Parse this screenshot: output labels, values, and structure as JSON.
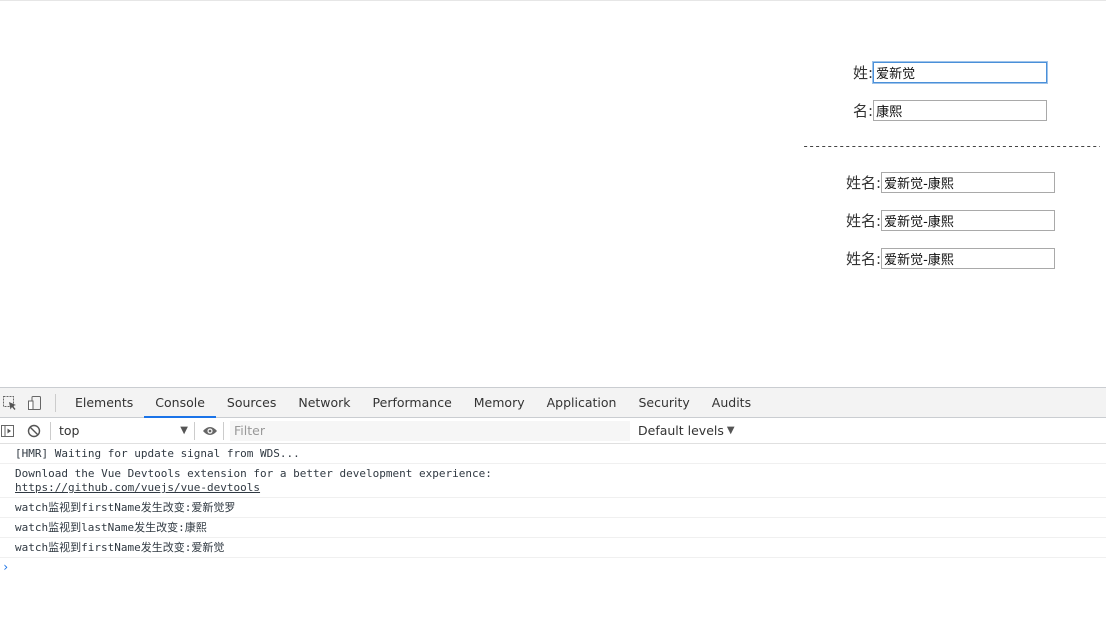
{
  "form": {
    "first_label": "姓:",
    "first_value": "爱新觉",
    "last_label": "名:",
    "last_value": "康熙",
    "divider": "-----------------------------------------------------------------------",
    "full_rows": [
      {
        "label": "姓名:",
        "value": "爱新觉-康熙"
      },
      {
        "label": "姓名:",
        "value": "爱新觉-康熙"
      },
      {
        "label": "姓名:",
        "value": "爱新觉-康熙"
      }
    ]
  },
  "devtools": {
    "tabs": [
      "Elements",
      "Console",
      "Sources",
      "Network",
      "Performance",
      "Memory",
      "Application",
      "Security",
      "Audits"
    ],
    "active_tab": "Console",
    "context": "top",
    "filter_placeholder": "Filter",
    "levels_label": "Default levels",
    "icons": [
      "inspect-element-icon",
      "device-toggle-icon",
      "sidebar-toggle-icon",
      "clear-console-icon",
      "eye-icon"
    ],
    "accent_color": "#1a73e8",
    "messages": [
      {
        "text": "[HMR] Waiting for update signal from WDS..."
      },
      {
        "text": "Download the Vue Devtools extension for a better development experience:",
        "link": "https://github.com/vuejs/vue-devtools"
      },
      {
        "text": "watch监视到firstName发生改变:爱新觉罗"
      },
      {
        "text": "watch监视到lastName发生改变:康熙"
      },
      {
        "text": "watch监视到firstName发生改变:爱新觉"
      }
    ],
    "prompt_symbol": "›"
  }
}
